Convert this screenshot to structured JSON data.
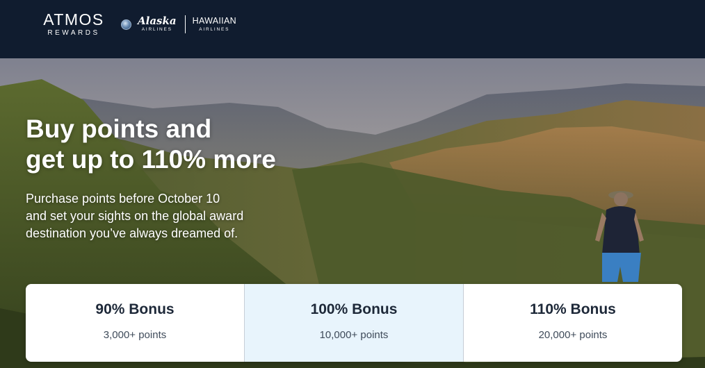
{
  "header": {
    "brand": {
      "main": "ATMOS",
      "sub": "REWARDS"
    },
    "partners": [
      {
        "name": "Alaska",
        "sub": "AIRLINES"
      },
      {
        "name": "HAWAIIAN",
        "sub": "AIRLINES"
      }
    ]
  },
  "hero": {
    "headline_line1": "Buy points and",
    "headline_line2": "get up to 110% more",
    "subcopy_line1": "Purchase points before October 10",
    "subcopy_line2": "and set your sights on the global award",
    "subcopy_line3": "destination you’ve always dreamed of."
  },
  "offers": [
    {
      "title": "90% Bonus",
      "points": "3,000+ points",
      "highlighted": false
    },
    {
      "title": "100% Bonus",
      "points": "10,000+ points",
      "highlighted": true
    },
    {
      "title": "110% Bonus",
      "points": "20,000+ points",
      "highlighted": false
    }
  ],
  "colors": {
    "header_bg": "#101c2f",
    "card_highlight_bg": "#e8f4fc",
    "text_dark": "#1d2838"
  }
}
